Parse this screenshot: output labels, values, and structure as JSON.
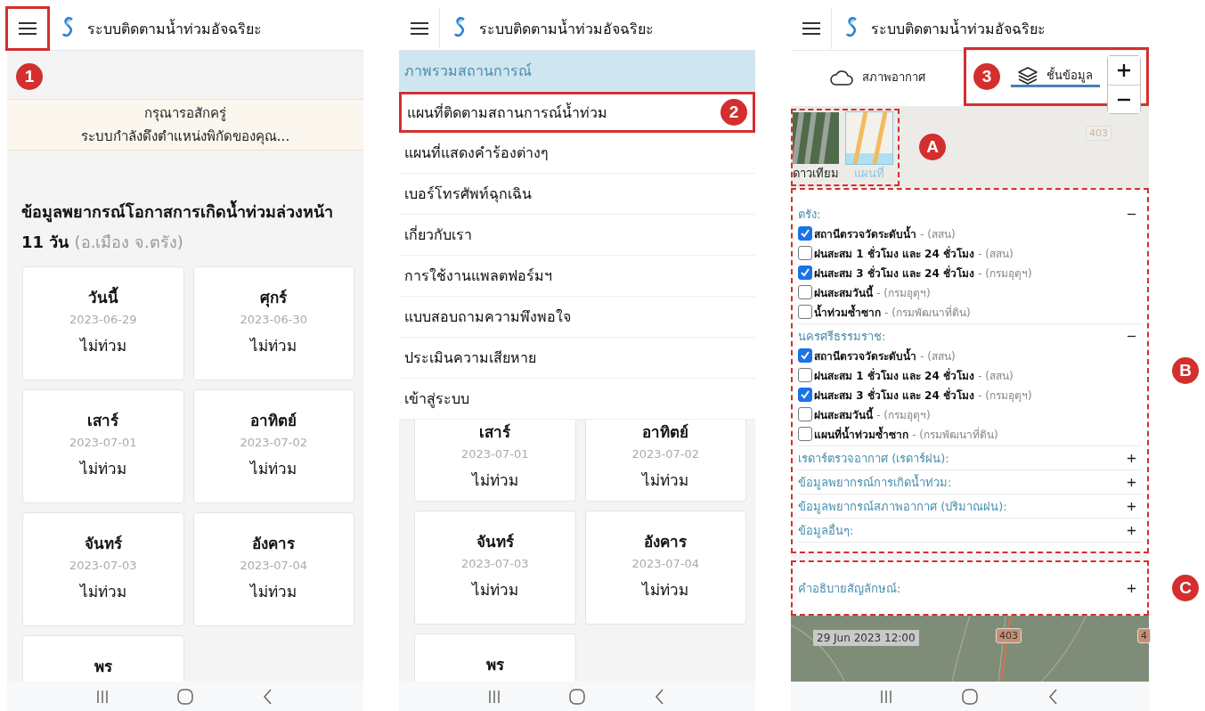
{
  "screen_1": {
    "header": {
      "title": "ระบบติดตามน้ำท่วมอัจฉริยะ",
      "menu_highlighted": true,
      "callout": "1"
    },
    "notice": [
      "กรุณารอสักครู่",
      "ระบบกำลังดึงตำแหน่งพิกัดของคุณ..."
    ],
    "forecast": {
      "title": "ข้อมูลพยากรณ์โอกาสการเกิดน้ำท่วมล่วงหน้า 11 วัน",
      "location": "(อ.เมือง จ.ตรัง)"
    },
    "cards": [
      {
        "day": "วันนี้",
        "date": "2023-06-29",
        "status": "ไม่ท่วม"
      },
      {
        "day": "ศุกร์",
        "date": "2023-06-30",
        "status": "ไม่ท่วม"
      },
      {
        "day": "เสาร์",
        "date": "2023-07-01",
        "status": "ไม่ท่วม"
      },
      {
        "day": "อาทิตย์",
        "date": "2023-07-02",
        "status": "ไม่ท่วม"
      },
      {
        "day": "จันทร์",
        "date": "2023-07-03",
        "status": "ไม่ท่วม"
      },
      {
        "day": "อังคาร",
        "date": "2023-07-04",
        "status": "ไม่ท่วม"
      },
      {
        "day": "พร"
      }
    ]
  },
  "screen_2": {
    "header": {
      "title": "ระบบติดตามน้ำท่วมอัจฉริยะ",
      "menu_highlighted": false
    },
    "menu": [
      {
        "label": "ภาพรวมสถานการณ์",
        "selected": true,
        "highlighted": false
      },
      {
        "label": "แผนที่ติดตามสถานการณ์น้ำท่วม",
        "selected": false,
        "highlighted": true,
        "callout": "2"
      },
      {
        "label": "แผนที่แสดงคำร้องต่างๆ",
        "selected": false,
        "highlighted": false
      },
      {
        "label": "เบอร์โทรศัพท์ฉุกเฉิน",
        "selected": false,
        "highlighted": false
      },
      {
        "label": "เกี่ยวกับเรา",
        "selected": false,
        "highlighted": false
      },
      {
        "label": "การใช้งานแพลตฟอร์มฯ",
        "selected": false,
        "highlighted": false
      },
      {
        "label": "แบบสอบถามความพึงพอใจ",
        "selected": false,
        "highlighted": false
      },
      {
        "label": "ประเมินความเสียหาย",
        "selected": false,
        "highlighted": false
      },
      {
        "label": "เข้าสู่ระบบ",
        "selected": false,
        "highlighted": false
      }
    ],
    "cards": [
      {
        "day": "เสาร์",
        "date": "2023-07-01",
        "status": "ไม่ท่วม"
      },
      {
        "day": "อาทิตย์",
        "date": "2023-07-02",
        "status": "ไม่ท่วม"
      },
      {
        "day": "จันทร์",
        "date": "2023-07-03",
        "status": "ไม่ท่วม"
      },
      {
        "day": "อังคาร",
        "date": "2023-07-04",
        "status": "ไม่ท่วม"
      },
      {
        "day": "พร"
      }
    ]
  },
  "screen_3": {
    "header": {
      "title": "ระบบติดตามน้ำท่วมอัจฉริยะ",
      "menu_highlighted": false
    },
    "tabs": [
      {
        "label": "สภาพอากาศ",
        "kind": "weather",
        "selected": false
      },
      {
        "label": "ชั้นข้อมูล",
        "kind": "layers",
        "selected": true
      }
    ],
    "callouts": {
      "layers": "3",
      "basemaps": "A",
      "layer_panel": "B",
      "legend": "C"
    },
    "map_label": "403",
    "basemaps": [
      {
        "label": "ดาวเทียม",
        "kind": "satellite",
        "selected": false
      },
      {
        "label": "แผนที่",
        "kind": "map",
        "selected": true
      }
    ],
    "groups": [
      {
        "title": "ตรัง:",
        "expanded": true,
        "items": [
          {
            "name": "สถานีตรวจวัดระดับน้ำ",
            "source": "- (สสน)",
            "checked": true
          },
          {
            "name": "ฝนสะสม 1 ชั่วโมง และ 24 ชั่วโมง",
            "source": "- (สสน)",
            "checked": false
          },
          {
            "name": "ฝนสะสม 3 ชั่วโมง และ 24 ชั่วโมง",
            "source": "- (กรมอุตุฯ)",
            "checked": true
          },
          {
            "name": "ฝนสะสมวันนี้",
            "source": "- (กรมอุตุฯ)",
            "checked": false
          },
          {
            "name": "น้ำท่วมซ้ำซาก",
            "source": "- (กรมพัฒนาที่ดิน)",
            "checked": false
          }
        ]
      },
      {
        "title": "นครศรีธรรมราช:",
        "expanded": true,
        "items": [
          {
            "name": "สถานีตรวจวัดระดับน้ำ",
            "source": "- (สสน)",
            "checked": true
          },
          {
            "name": "ฝนสะสม 1 ชั่วโมง และ 24 ชั่วโมง",
            "source": "- (สสน)",
            "checked": false
          },
          {
            "name": "ฝนสะสม 3 ชั่วโมง และ 24 ชั่วโมง",
            "source": "- (กรมอุตุฯ)",
            "checked": true
          },
          {
            "name": "ฝนสะสมวันนี้",
            "source": "- (กรมอุตุฯ)",
            "checked": false
          },
          {
            "name": "แผนที่น้ำท่วมซ้ำซาก",
            "source": "- (กรมพัฒนาที่ดิน)",
            "checked": false
          }
        ]
      },
      {
        "title": "เรดาร์ตรวจอากาศ (เรดาร์ฝน):",
        "expanded": false
      },
      {
        "title": "ข้อมูลพยากรณ์การเกิดน้ำท่วม:",
        "expanded": false
      },
      {
        "title": "ข้อมูลพยากรณ์สภาพอากาศ (ปริมาณฝน):",
        "expanded": false
      },
      {
        "title": "ข้อมูลอื่นๆ:",
        "expanded": false
      }
    ],
    "legend": {
      "title": "คำอธิบายสัญลักษณ์:",
      "expanded": false
    },
    "timeline": {
      "time": "29 Jun 2023 12:00",
      "road_labels": [
        "403",
        "4"
      ]
    }
  }
}
